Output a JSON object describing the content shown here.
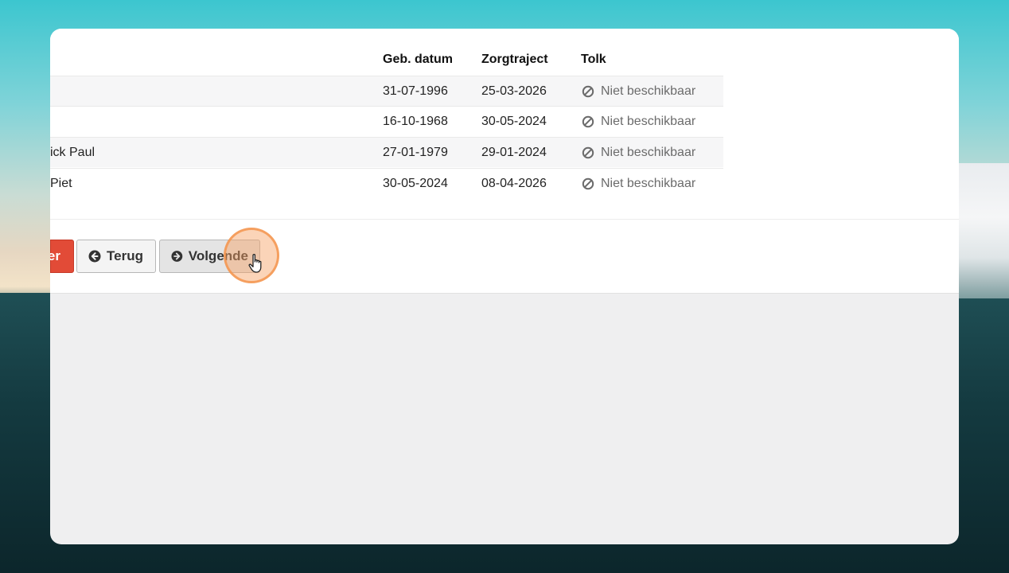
{
  "table": {
    "headers": {
      "dob": "Geb. datum",
      "trajectory": "Zorgtraject",
      "interpreter": "Tolk"
    },
    "rows": [
      {
        "name": "",
        "dob": "31-07-1996",
        "trajectory": "25-03-2026",
        "interpreter": "Niet beschikbaar"
      },
      {
        "name": "",
        "dob": "16-10-1968",
        "trajectory": "30-05-2024",
        "interpreter": "Niet beschikbaar"
      },
      {
        "name": "ick Paul",
        "dob": "27-01-1979",
        "trajectory": "29-01-2024",
        "interpreter": "Niet beschikbaar"
      },
      {
        "name": "Piet",
        "dob": "30-05-2024",
        "trajectory": "08-04-2026",
        "interpreter": "Niet beschikbaar"
      }
    ]
  },
  "buttons": {
    "danger_label": "er",
    "back_label": "Terug",
    "next_label": "Volgende"
  },
  "icons": {
    "interpreter_status": "ban-icon",
    "back": "arrow-circle-left-icon",
    "next": "arrow-circle-right-icon",
    "cursor": "hand-pointer-icon"
  },
  "colors": {
    "danger": "#e24b37",
    "click_highlight": "#f7a062"
  }
}
